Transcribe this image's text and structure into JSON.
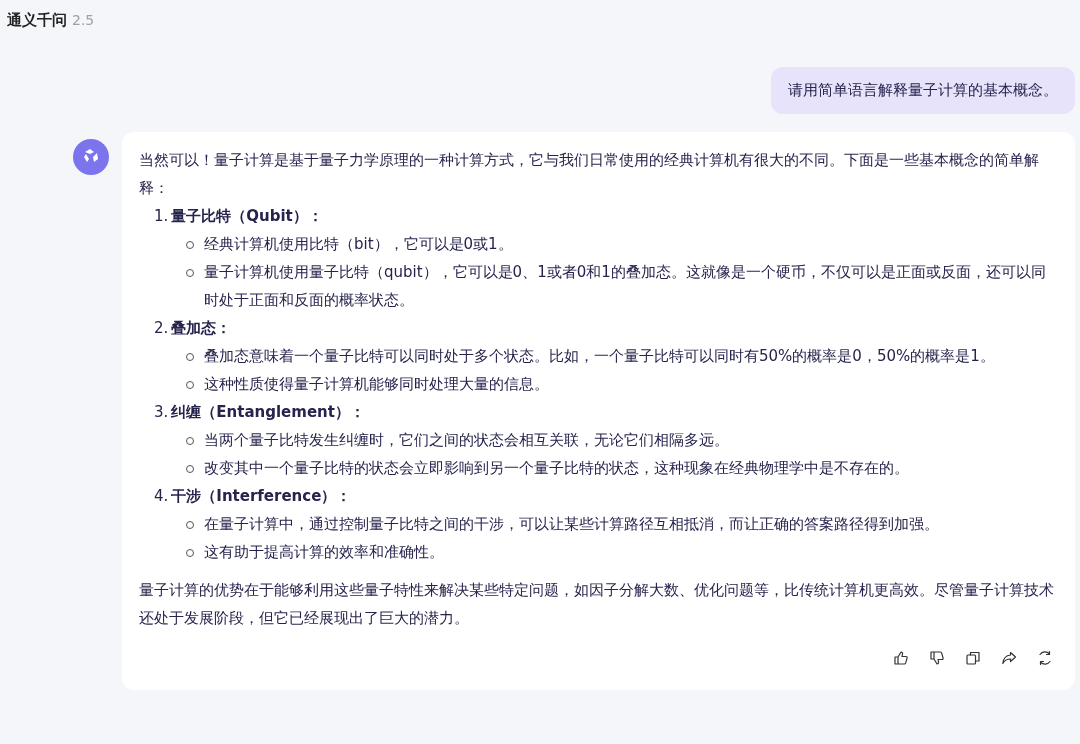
{
  "app": {
    "title": "通义千问",
    "version": "2.5"
  },
  "user_message": {
    "text": "请用简单语言解释量子计算的基本概念。"
  },
  "answer": {
    "intro": "当然可以！量子计算是基于量子力学原理的一种计算方式，它与我们日常使用的经典计算机有很大的不同。下面是一些基本概念的简单解释：",
    "sections": [
      {
        "number": "1.",
        "title": "量子比特（Qubit）：",
        "points": [
          "经典计算机使用比特（bit），它可以是0或1。",
          "量子计算机使用量子比特（qubit），它可以是0、1或者0和1的叠加态。这就像是一个硬币，不仅可以是正面或反面，还可以同时处于正面和反面的概率状态。"
        ]
      },
      {
        "number": "2.",
        "title": "叠加态：",
        "points": [
          "叠加态意味着一个量子比特可以同时处于多个状态。比如，一个量子比特可以同时有50%的概率是0，50%的概率是1。",
          "这种性质使得量子计算机能够同时处理大量的信息。"
        ]
      },
      {
        "number": "3.",
        "title": "纠缠（Entanglement）：",
        "points": [
          "当两个量子比特发生纠缠时，它们之间的状态会相互关联，无论它们相隔多远。",
          "改变其中一个量子比特的状态会立即影响到另一个量子比特的状态，这种现象在经典物理学中是不存在的。"
        ]
      },
      {
        "number": "4.",
        "title": "干涉（Interference）：",
        "points": [
          "在量子计算中，通过控制量子比特之间的干涉，可以让某些计算路径互相抵消，而让正确的答案路径得到加强。",
          "这有助于提高计算的效率和准确性。"
        ]
      }
    ],
    "conclusion": "量子计算的优势在于能够利用这些量子特性来解决某些特定问题，如因子分解大数、优化问题等，比传统计算机更高效。尽管量子计算技术还处于发展阶段，但它已经展现出了巨大的潜力。"
  },
  "actions": [
    {
      "kind": "like"
    },
    {
      "kind": "dislike"
    },
    {
      "kind": "copy"
    },
    {
      "kind": "share"
    },
    {
      "kind": "regenerate"
    }
  ]
}
